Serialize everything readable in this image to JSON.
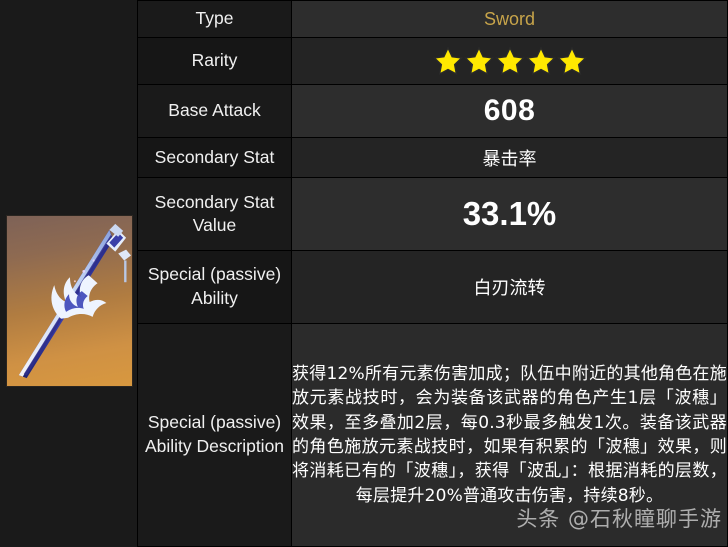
{
  "weapon": {
    "artwork_name": "mistsplitter-reforged-sword",
    "blade_color": "#2b2f8f",
    "edge_color": "#e8f1ff",
    "bg_gradient_top": "#7e6257",
    "bg_gradient_bottom": "#d8983f"
  },
  "table": {
    "rows": [
      {
        "label": "Type",
        "value": "Sword",
        "kind": "type"
      },
      {
        "label": "Rarity",
        "value": "5",
        "kind": "stars"
      },
      {
        "label": "Base Attack",
        "value": "608",
        "kind": "big"
      },
      {
        "label": "Secondary\nStat",
        "value": "暴击率",
        "kind": "cn"
      },
      {
        "label": "Secondary\nStat Value",
        "value": "33.1%",
        "kind": "pct"
      },
      {
        "label": "Special\n(passive)\nAbility",
        "value": "白刃流转",
        "kind": "cn"
      },
      {
        "label": "Special\n(passive)\nAbility\nDescription",
        "value": "",
        "kind": "desc"
      }
    ],
    "row_labels": {
      "type": "Type",
      "rarity": "Rarity",
      "base_attack": "Base Attack",
      "secondary_stat": "Secondary Stat",
      "secondary_stat_value": "Secondary Stat Value",
      "special_ability": "Special (passive) Ability",
      "special_ability_description": "Special (passive) Ability Description"
    },
    "values": {
      "type": "Sword",
      "rarity_stars": 5,
      "base_attack": "608",
      "secondary_stat": "暴击率",
      "secondary_stat_value": "33.1%",
      "special_ability": "白刃流转",
      "special_ability_description": "获得12%所有元素伤害加成；队伍中附近的其他角色在施放元素战技时，会为装备该武器的角色产生1层「波穗」效果，至多叠加2层，每0.3秒最多触发1次。装备该武器的角色施放元素战技时，如果有积累的「波穗」效果，则将消耗已有的「波穗」，获得「波乱」：根据消耗的层数，每层提升20%普通攻击伤害，持续8秒。"
    }
  },
  "watermark": {
    "text": "头条 @石秋瞳聊手游"
  },
  "colors": {
    "type_gold": "#c7a44a",
    "star_yellow": "#ffe800",
    "value_white": "#ffffff",
    "row_dark": "#242424",
    "row_light": "#2d2d2d",
    "label_bg": "#1a1a1a"
  }
}
